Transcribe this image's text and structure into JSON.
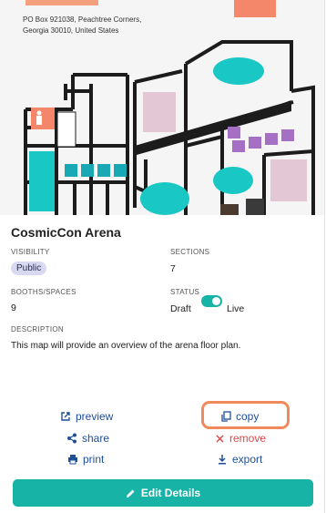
{
  "venue": {
    "address_line1": "PO Box 921038, Peachtree Corners,",
    "address_line2": "Georgia 30010, United States",
    "name": "CosmicCon Arena"
  },
  "details": {
    "visibility_label": "VISIBILITY",
    "visibility_value": "Public",
    "sections_label": "SECTIONS",
    "sections_value": "7",
    "booths_label": "BOOTHS/SPACES",
    "booths_value": "9",
    "status_label": "STATUS",
    "status_draft": "Draft",
    "status_live": "Live",
    "status_is_live": true,
    "description_label": "DESCRIPTION",
    "description": "This map will provide an overview of the arena floor plan."
  },
  "actions": {
    "preview": "preview",
    "copy": "copy",
    "share": "share",
    "remove": "remove",
    "print": "print",
    "export": "export",
    "edit_details": "Edit Details"
  },
  "colors": {
    "accent": "#17b3a7",
    "link": "#1f4f99",
    "danger": "#d94848",
    "highlight": "#f08a5d",
    "badge": "#d8d9f0"
  },
  "icons": {
    "preview": "external-link-icon",
    "copy": "copy-icon",
    "share": "share-icon",
    "remove": "close-icon",
    "print": "printer-icon",
    "export": "download-icon",
    "edit": "pencil-icon"
  }
}
